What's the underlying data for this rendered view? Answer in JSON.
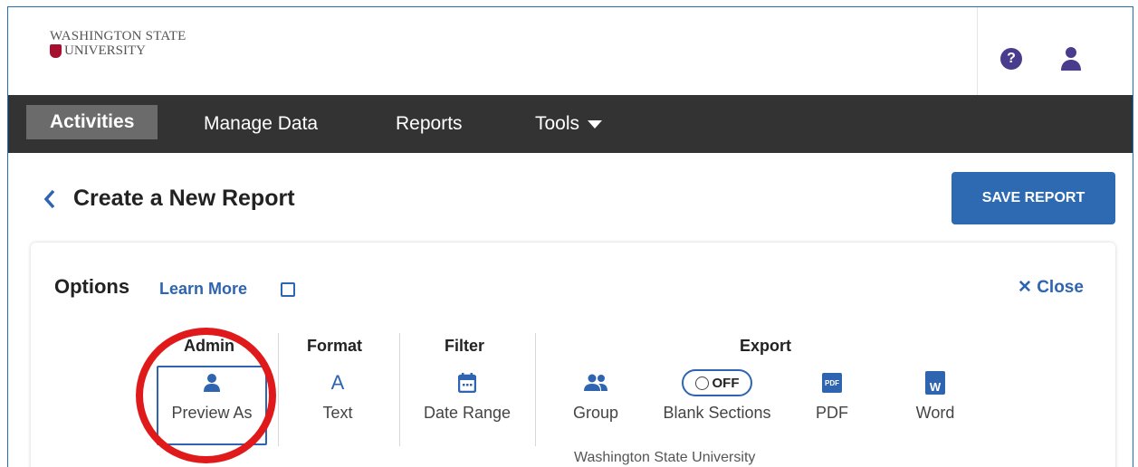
{
  "logo": {
    "line1": "WASHINGTON STATE",
    "line2": "UNIVERSITY"
  },
  "nav": {
    "items": [
      "Activities",
      "Manage Data",
      "Reports",
      "Tools"
    ]
  },
  "page": {
    "title": "Create a New Report",
    "save_label": "SAVE REPORT"
  },
  "options": {
    "title": "Options",
    "learn_more": "Learn More",
    "close_label": "Close",
    "groups": {
      "admin": "Admin",
      "format": "Format",
      "filter": "Filter",
      "export": "Export"
    },
    "tools": {
      "preview_as": "Preview As",
      "text": "Text",
      "text_glyph": "A",
      "date_range": "Date Range",
      "group": "Group",
      "blank_sections": "Blank Sections",
      "toggle_state": "OFF",
      "pdf": "PDF",
      "pdf_glyph": "PDF",
      "word": "Word",
      "word_glyph": "W"
    },
    "underlying_text": "Washington State University"
  },
  "colors": {
    "accent": "#2e64b0",
    "nav_bg": "#333333",
    "highlight_ring": "#e01a1a",
    "brand": "#a60f2d"
  }
}
